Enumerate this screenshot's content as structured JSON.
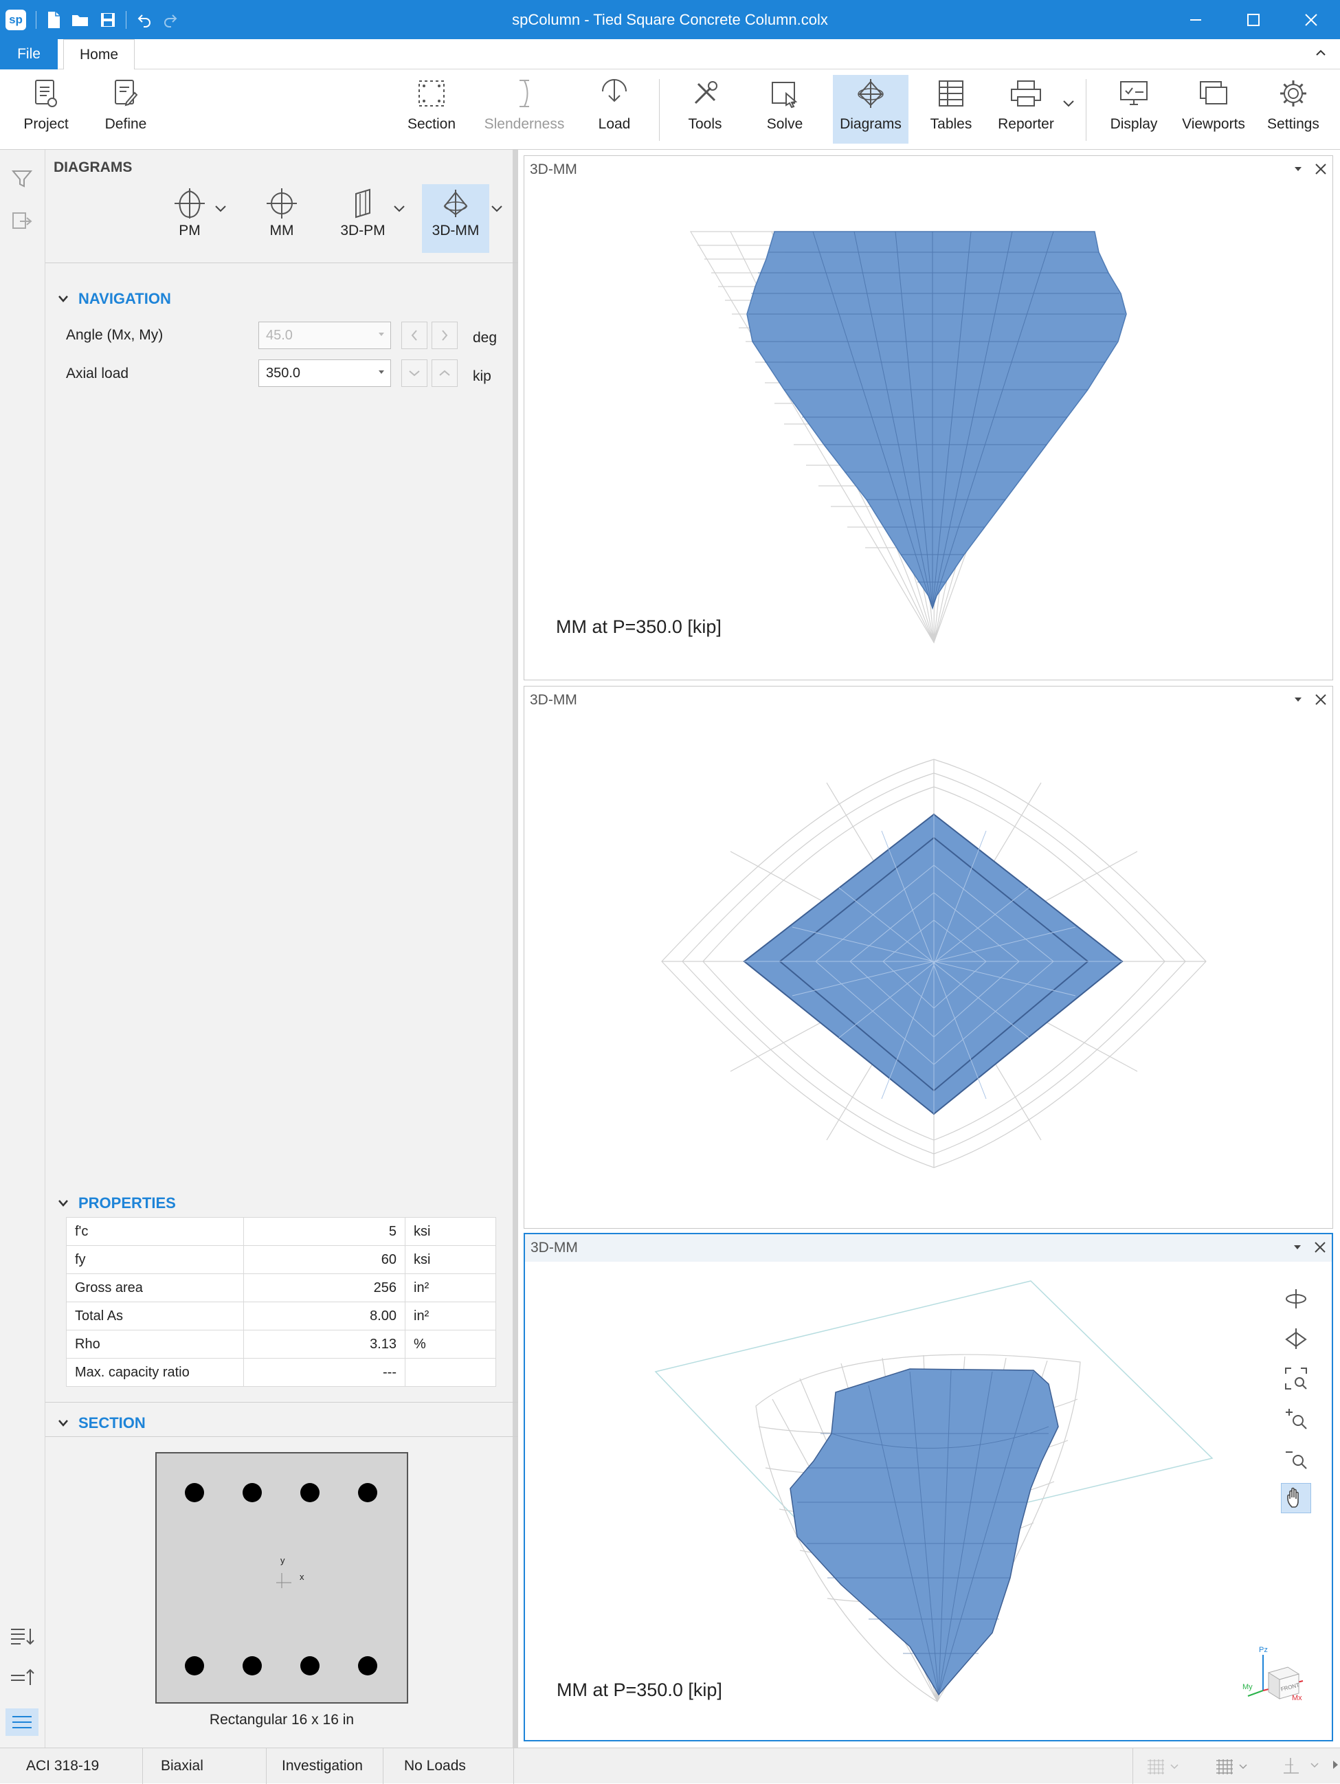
{
  "window": {
    "title": "spColumn - Tied Square Concrete Column.colx",
    "logo": "sp",
    "controls": [
      "minimize-icon",
      "maximize-icon",
      "close-icon"
    ]
  },
  "tabs": {
    "file": "File",
    "home": "Home"
  },
  "ribbon": {
    "project": "Project",
    "define": "Define",
    "section": "Section",
    "slenderness": "Slenderness",
    "load": "Load",
    "tools": "Tools",
    "solve": "Solve",
    "diagrams": "Diagrams",
    "tables": "Tables",
    "reporter": "Reporter",
    "display": "Display",
    "viewports": "Viewports",
    "settings": "Settings"
  },
  "panel": {
    "title": "DIAGRAMS",
    "diagram_buttons": [
      "PM",
      "MM",
      "3D-PM",
      "3D-MM"
    ],
    "navigation": {
      "heading": "NAVIGATION",
      "angle_label": "Angle (Mx, My)",
      "angle_value": "45.0",
      "angle_unit": "deg",
      "axial_label": "Axial load",
      "axial_value": "350.0",
      "axial_unit": "kip"
    },
    "properties": {
      "heading": "PROPERTIES",
      "rows": [
        {
          "label": "f'c",
          "value": "5",
          "unit": "ksi"
        },
        {
          "label": "fy",
          "value": "60",
          "unit": "ksi"
        },
        {
          "label": "Gross area",
          "value": "256",
          "unit": "in²"
        },
        {
          "label": "Total As",
          "value": "8.00",
          "unit": "in²"
        },
        {
          "label": "Rho",
          "value": "3.13",
          "unit": "%"
        },
        {
          "label": "Max. capacity ratio",
          "value": "---",
          "unit": ""
        }
      ]
    },
    "section": {
      "heading": "SECTION",
      "caption": "Rectangular 16 x 16 in",
      "axis_y": "y",
      "axis_x": "x"
    }
  },
  "viewports": [
    {
      "title": "3D-MM",
      "caption": "MM at P=350.0 [kip]"
    },
    {
      "title": "3D-MM",
      "caption": ""
    },
    {
      "title": "3D-MM",
      "caption": "MM at P=350.0 [kip]"
    }
  ],
  "view_cube": {
    "axis_z": "Pz",
    "axis_x": "Mx",
    "axis_y": "My",
    "face": "FRONT"
  },
  "status": {
    "code": "ACI 318-19",
    "mode": "Biaxial",
    "run": "Investigation",
    "loads": "No Loads"
  },
  "colors": {
    "accent": "#1e84d8",
    "surface": "#6f9ad0",
    "mesh": "#d6d6d6"
  }
}
